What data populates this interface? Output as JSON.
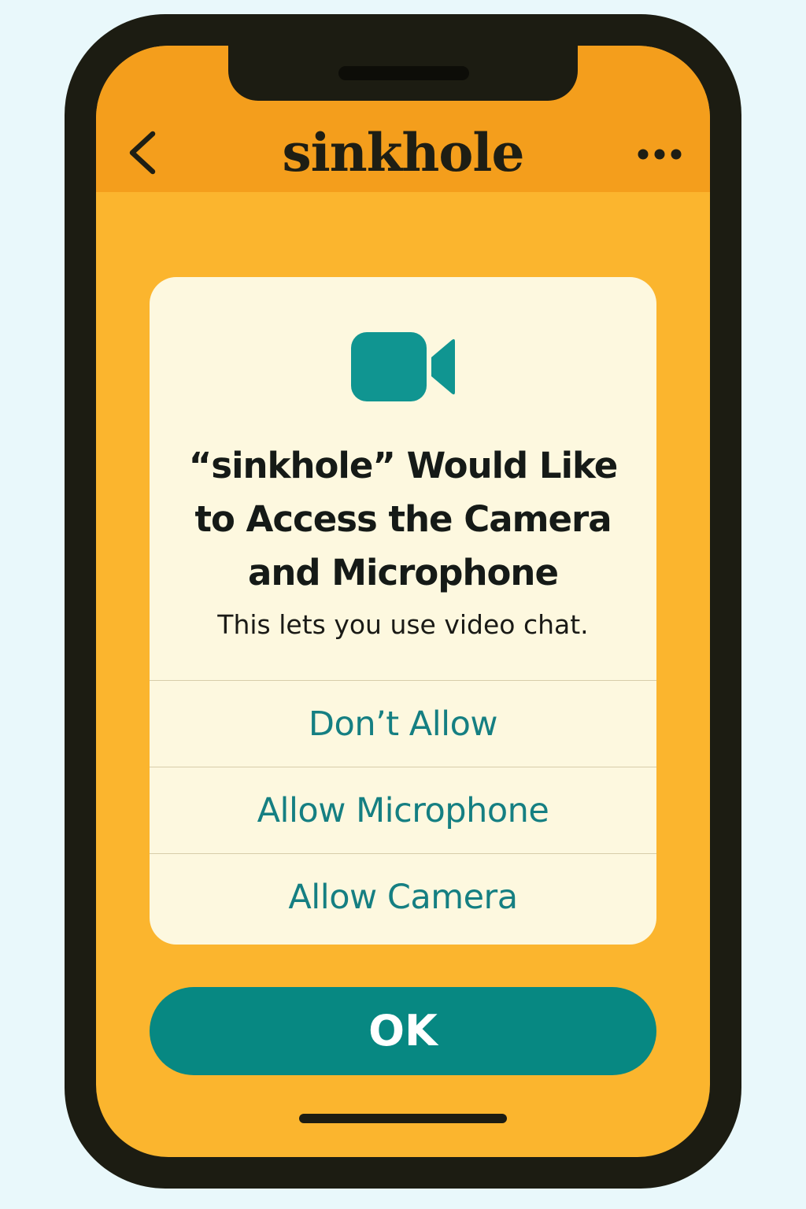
{
  "header": {
    "title": "sinkhole",
    "back_icon": "chevron-left-icon",
    "more_icon": "more-horizontal-icon"
  },
  "dialog": {
    "icon": "video-camera-icon",
    "title_lines": [
      "“sinkhole” Would Like",
      "to Access the Camera",
      "and Microphone"
    ],
    "message": "This lets you use video chat.",
    "options": [
      {
        "label": "Don’t Allow"
      },
      {
        "label": "Allow Microphone"
      },
      {
        "label": "Allow Camera"
      }
    ]
  },
  "ok_button": {
    "label": "OK"
  },
  "colors": {
    "background": "#e9f8fb",
    "phone_frame": "#1c1c12",
    "screen": "#fbb52e",
    "header": "#f49e1c",
    "dialog": "#fdf8df",
    "accent": "#078882",
    "option_text": "#157f82"
  }
}
